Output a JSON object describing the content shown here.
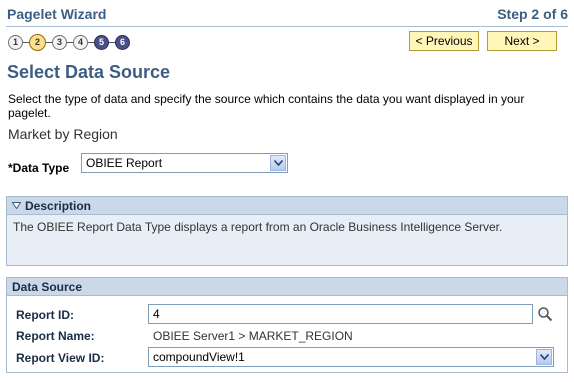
{
  "wizard": {
    "title": "Pagelet Wizard",
    "step_text": "Step 2 of 6",
    "steps": [
      "1",
      "2",
      "3",
      "4",
      "5",
      "6"
    ],
    "prev_label": "< Previous",
    "next_label": "Next >"
  },
  "page": {
    "title": "Select Data Source",
    "instructions": "Select the type of data and specify the source which contains the data you want displayed in your pagelet.",
    "subtitle": "Market by Region"
  },
  "data_type": {
    "label": "*Data Type",
    "value": "OBIEE Report"
  },
  "description": {
    "header": "Description",
    "text": "The OBIEE Report Data Type displays a report from an Oracle Business Intelligence Server."
  },
  "data_source": {
    "header": "Data Source",
    "report_id_label": "Report ID:",
    "report_id_value": "4",
    "report_name_label": "Report Name:",
    "report_name_value": "OBIEE Server1 > MARKET_REGION",
    "report_view_label": "Report View ID:",
    "report_view_value": "compoundView!1"
  },
  "colors": {
    "title_blue": "#3c5e84",
    "group_header_bg": "#cad8e8",
    "group_bg": "#e7eef6",
    "button_bg": "#fff6b8",
    "current_step": "#ffe08a",
    "future_step": "#4a4f86"
  },
  "icons": [
    "search-icon",
    "chevron-down-icon",
    "collapse-triangle-icon"
  ]
}
